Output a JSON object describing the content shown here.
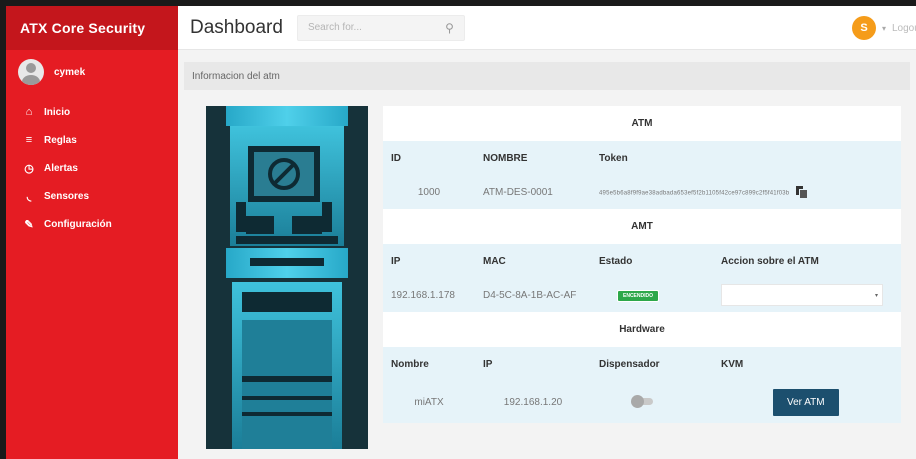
{
  "sidebar": {
    "brand": "ATX Core Security",
    "username": "cymek",
    "items": [
      {
        "icon": "home-icon",
        "glyph": "⌂",
        "label": "Inicio"
      },
      {
        "icon": "rules-icon",
        "glyph": "≡",
        "label": "Reglas"
      },
      {
        "icon": "alarm-icon",
        "glyph": "◷",
        "label": "Alertas"
      },
      {
        "icon": "rss-icon",
        "glyph": "◟",
        "label": "Sensores"
      },
      {
        "icon": "wrench-icon",
        "glyph": "✎",
        "label": "Configuración"
      }
    ]
  },
  "header": {
    "title": "Dashboard",
    "search_placeholder": "Search for...",
    "user_initial": "S",
    "logout": "Logout"
  },
  "content": {
    "info_title": "Informacion del atm",
    "atm": {
      "section_title": "ATM",
      "headers": [
        "ID",
        "NOMBRE",
        "Token"
      ],
      "values": {
        "id": "1000",
        "nombre": "ATM-DES-0001",
        "token": "495e5b6a8f9f9ae38adbada653ef5f2b1105f42ce97c899c2f5f41f03b"
      }
    },
    "amt": {
      "section_title": "AMT",
      "headers": [
        "IP",
        "MAC",
        "Estado",
        "Accion sobre el ATM"
      ],
      "values": {
        "ip": "192.168.1.178",
        "mac": "D4-5C-8A-1B-AC-AF",
        "estado": "ENCENDIDO",
        "accion": ""
      }
    },
    "hardware": {
      "section_title": "Hardware",
      "headers": [
        "Nombre",
        "IP",
        "Dispensador",
        "KVM"
      ],
      "values": {
        "nombre": "miATX",
        "ip": "192.168.1.20",
        "dispensador_on": false,
        "kvm_button": "Ver ATM"
      }
    }
  },
  "colors": {
    "sidebar": "#e51c23",
    "brand_bar": "#c4161c",
    "user_badge": "#f59c1a",
    "status_on": "#2ea84a",
    "button": "#1c4f6e",
    "table_bg": "#e6f3f9"
  }
}
